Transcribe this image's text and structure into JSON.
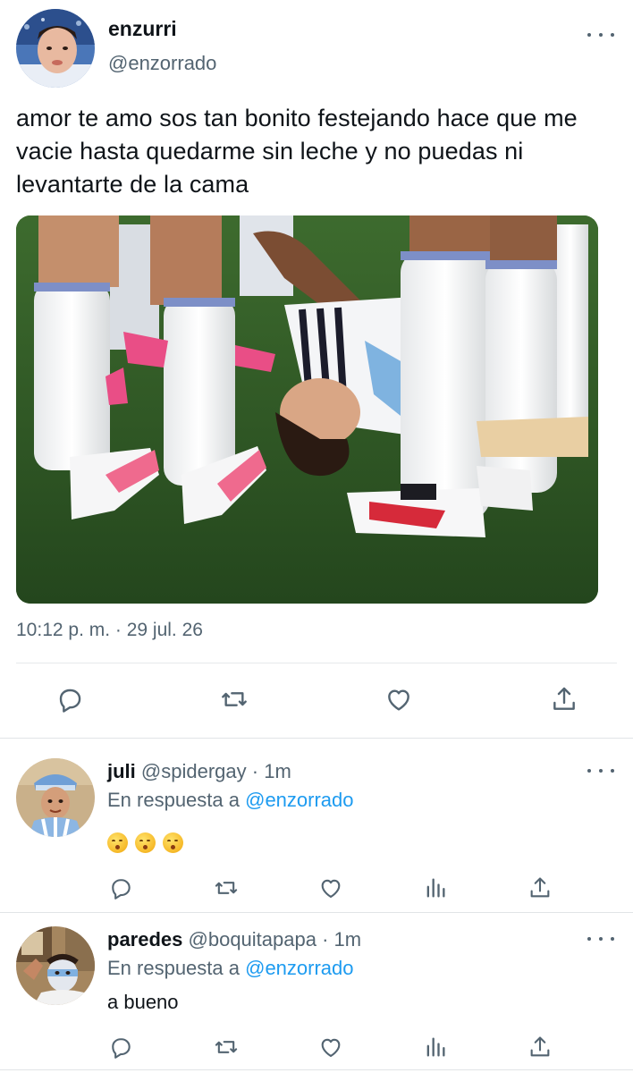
{
  "tweet": {
    "author_name": "enzurri",
    "author_handle": "@enzorrado",
    "text": "amor te amo sos tan bonito festejando hace que me vacie hasta quedarme sin leche y no puedas ni levantarte de la cama",
    "timestamp": "10:12 p. m. · 29 jul. 26",
    "media_icon": "photo-of-players-celebrating"
  },
  "actions": {
    "reply_icon": "reply-icon",
    "retweet_icon": "retweet-icon",
    "like_icon": "heart-icon",
    "share_icon": "share-icon",
    "views_icon": "views-icon"
  },
  "replies": [
    {
      "name": "juli",
      "handle": "@spidergay",
      "separator": "·",
      "time": "1m",
      "in_reply_prefix": "En respuesta a",
      "in_reply_handle": "@enzorrado",
      "body": "",
      "emojis": [
        "kissing-face",
        "kissing-face",
        "kissing-face"
      ]
    },
    {
      "name": "paredes",
      "handle": "@boquitapapa",
      "separator": "·",
      "time": "1m",
      "in_reply_prefix": "En respuesta a",
      "in_reply_handle": "@enzorrado",
      "body": "a bueno",
      "emojis": []
    }
  ],
  "colors": {
    "text": "#0f1419",
    "secondary": "#536471",
    "link": "#1d9bf0",
    "divider": "#e6e9eb"
  }
}
